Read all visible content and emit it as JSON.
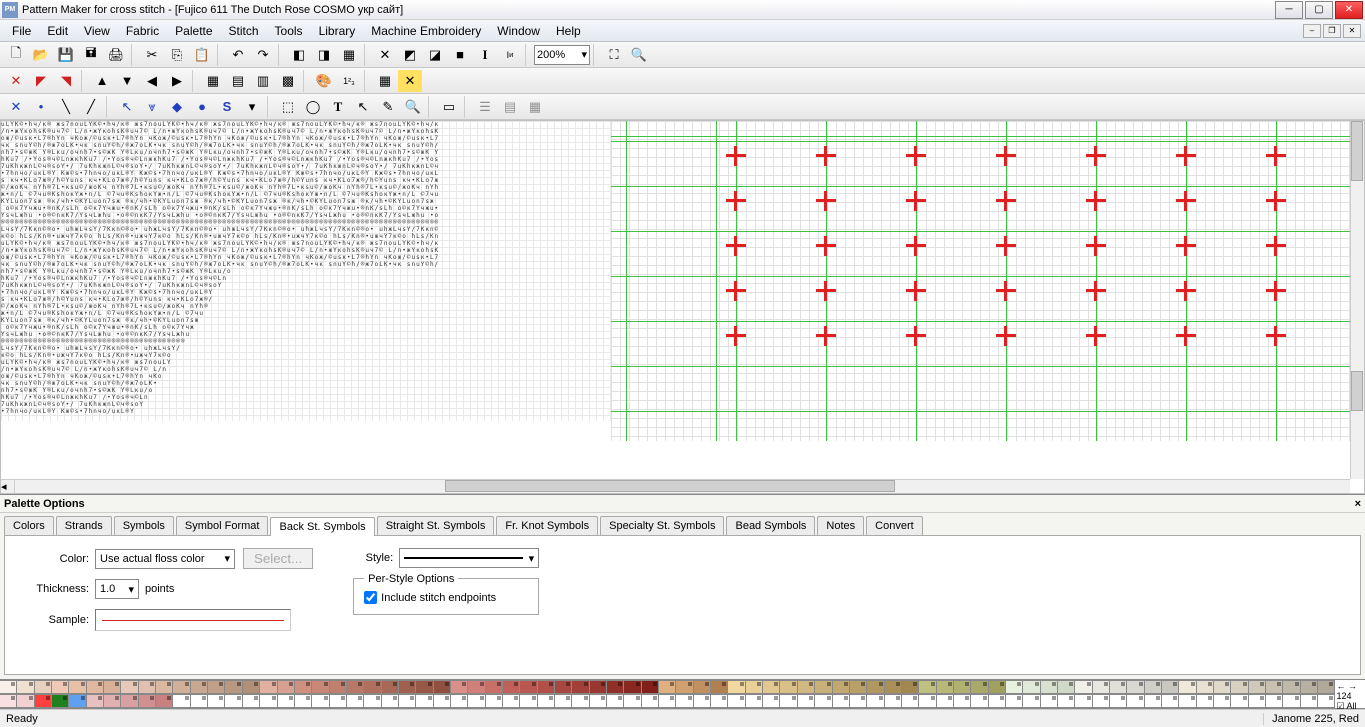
{
  "window": {
    "title": "Pattern Maker for cross stitch - [Fujico 611 The Dutch Rose COSMO укр сайт]",
    "app_icon": "PM"
  },
  "menu": [
    "File",
    "Edit",
    "View",
    "Fabric",
    "Palette",
    "Stitch",
    "Tools",
    "Library",
    "Machine Embroidery",
    "Window",
    "Help"
  ],
  "zoom": "200%",
  "palette_panel": {
    "title": "Palette Options",
    "tabs": [
      "Colors",
      "Strands",
      "Symbols",
      "Symbol Format",
      "Back St. Symbols",
      "Straight St. Symbols",
      "Fr. Knot Symbols",
      "Specialty St. Symbols",
      "Bead Symbols",
      "Notes",
      "Convert"
    ],
    "active_tab": 4,
    "form": {
      "color_label": "Color:",
      "color_value": "Use actual floss color",
      "select_btn": "Select...",
      "thickness_label": "Thickness:",
      "thickness_value": "1.0",
      "thickness_unit": "points",
      "sample_label": "Sample:",
      "style_label": "Style:",
      "fieldset_title": "Per-Style Options",
      "include_endpoints": "Include stitch endpoints"
    }
  },
  "strip": {
    "count_label": "124",
    "all_label": "All"
  },
  "status": {
    "left": "Ready",
    "right": "Janome  225, Red"
  },
  "colors_row1": [
    "#f8f0e8",
    "#f0e0d0",
    "#e8d0c0",
    "#f0c8b8",
    "#e8c0a8",
    "#e0b8a0",
    "#d8b098",
    "#e8c8b8",
    "#e0c0b0",
    "#d8b8a0",
    "#d0b098",
    "#c8a890",
    "#c0a088",
    "#b89880",
    "#b09078",
    "#e0b0a0",
    "#d8a090",
    "#d09080",
    "#c88878",
    "#c08070",
    "#b87868",
    "#b07060",
    "#a86858",
    "#a06050",
    "#985848",
    "#905040",
    "#d89088",
    "#d08078",
    "#c87068",
    "#c06058",
    "#b85850",
    "#b05048",
    "#a84840",
    "#a04038",
    "#983830",
    "#903028",
    "#882820",
    "#802018",
    "#e0b080",
    "#d0a070",
    "#c09060",
    "#b08050",
    "#f0d8a0",
    "#e8d098",
    "#e0c890",
    "#d8c088",
    "#d0b880",
    "#c8b078",
    "#c0a870",
    "#b8a068",
    "#b09860",
    "#a89058",
    "#a08850",
    "#c0c080",
    "#b8b878",
    "#b0b070",
    "#a8a868",
    "#a0a060",
    "#e8f0e0",
    "#e0e8d8",
    "#d8e0d0",
    "#d0d8c8",
    "#f0f0e8",
    "#e8e8e0",
    "#e0e0d8",
    "#d8d8d0",
    "#d0d0c8",
    "#c8c8c0",
    "#f0e8d8",
    "#e8e0d0",
    "#e0d8c8",
    "#d8d0c0",
    "#d0c8b8",
    "#c8c0b0",
    "#c0b8a8",
    "#b8b0a0",
    "#b0a898"
  ],
  "colors_row2": [
    "#f8e0e0",
    "#f0d0d0",
    "#ff4040",
    "#208020",
    "#60a0f0",
    "#e8c0c0",
    "#e0b0b0",
    "#d8a0a0",
    "#d09090",
    "#c88080",
    "#ffffff",
    "#ffffff",
    "#ffffff",
    "#ffffff",
    "#ffffff",
    "#ffffff",
    "#ffffff",
    "#ffffff",
    "#ffffff",
    "#ffffff",
    "#ffffff",
    "#ffffff",
    "#ffffff",
    "#ffffff",
    "#ffffff",
    "#ffffff",
    "#ffffff",
    "#ffffff",
    "#ffffff",
    "#ffffff",
    "#ffffff",
    "#ffffff",
    "#ffffff",
    "#ffffff",
    "#ffffff",
    "#ffffff",
    "#ffffff",
    "#ffffff",
    "#ffffff",
    "#ffffff",
    "#ffffff",
    "#ffffff",
    "#ffffff",
    "#ffffff",
    "#ffffff",
    "#ffffff",
    "#ffffff",
    "#ffffff",
    "#ffffff",
    "#ffffff",
    "#ffffff",
    "#ffffff",
    "#ffffff",
    "#ffffff",
    "#ffffff",
    "#ffffff",
    "#ffffff",
    "#ffffff",
    "#ffffff",
    "#ffffff",
    "#ffffff",
    "#ffffff",
    "#ffffff",
    "#ffffff",
    "#ffffff",
    "#ffffff",
    "#ffffff",
    "#ffffff",
    "#ffffff",
    "#ffffff",
    "#ffffff",
    "#ffffff",
    "#ffffff",
    "#ffffff",
    "#ffffff",
    "#ffffff",
    "#ffffff"
  ]
}
